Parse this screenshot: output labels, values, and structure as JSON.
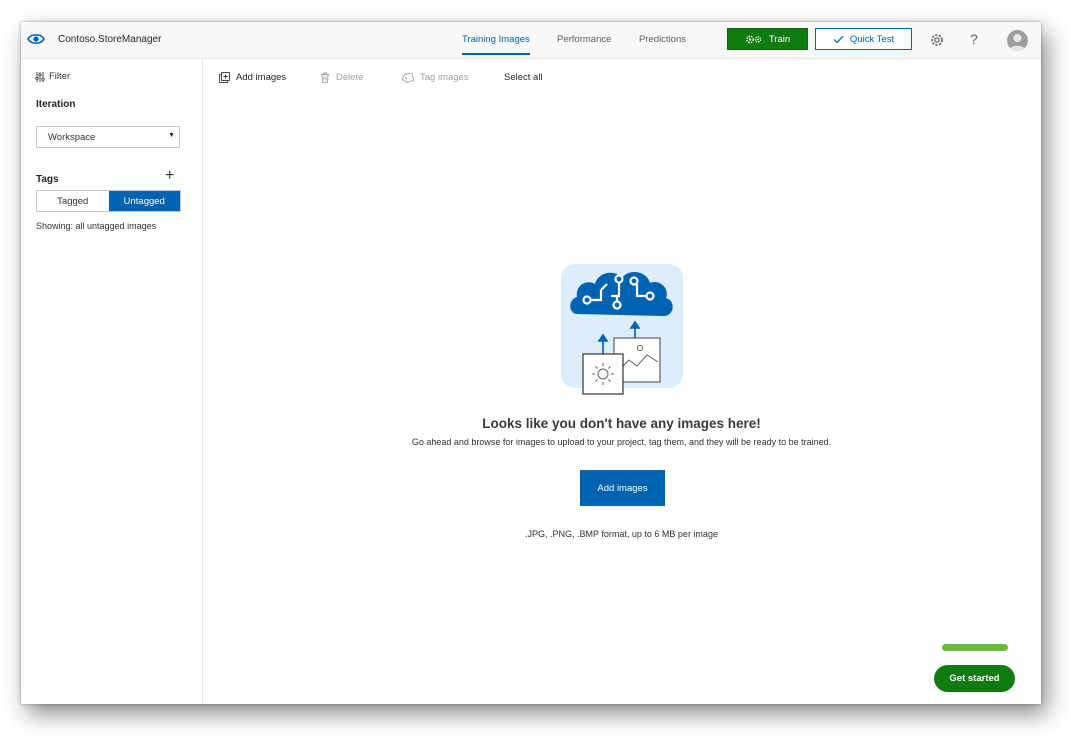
{
  "header": {
    "app_title": "Contoso.StoreManager",
    "tabs": [
      {
        "label": "Training Images",
        "active": true
      },
      {
        "label": "Performance",
        "active": false
      },
      {
        "label": "Predictions",
        "active": false
      }
    ],
    "train_label": "Train",
    "quick_test_label": "Quick Test",
    "help_label": "?"
  },
  "sidebar": {
    "filter_label": "Filter",
    "iteration_label": "Iteration",
    "iteration_value": "Workspace",
    "tags_label": "Tags",
    "toggle": {
      "tagged": "Tagged",
      "untagged": "Untagged"
    },
    "showing_text": "Showing: all untagged images"
  },
  "toolbar": {
    "add_images": "Add images",
    "delete": "Delete",
    "tag_images": "Tag images",
    "select_all": "Select all"
  },
  "empty_state": {
    "title": "Looks like you don't have any images here!",
    "description": "Go ahead and browse for images to upload to your project, tag them, and they will be ready to be trained.",
    "add_button": "Add images",
    "formats": ".JPG, .PNG, .BMP format, up to 6 MB per image"
  },
  "get_started": {
    "label": "Get started",
    "progress": 1.0
  },
  "colors": {
    "accent_blue": "#0063b1",
    "train_green": "#107c10",
    "progress_green": "#6bb83b"
  },
  "icons": {
    "brand": "eye-icon",
    "train": "gears-icon",
    "quick_test": "checkmark-icon",
    "settings": "gear-icon",
    "help": "question-icon",
    "avatar": "user-avatar",
    "filter": "sliders-icon",
    "add_tag": "plus-icon",
    "add_images": "add-image-icon",
    "delete": "trash-icon",
    "tag_images": "tag-icon",
    "illustration": "brain-circuit-upload-illustration"
  }
}
